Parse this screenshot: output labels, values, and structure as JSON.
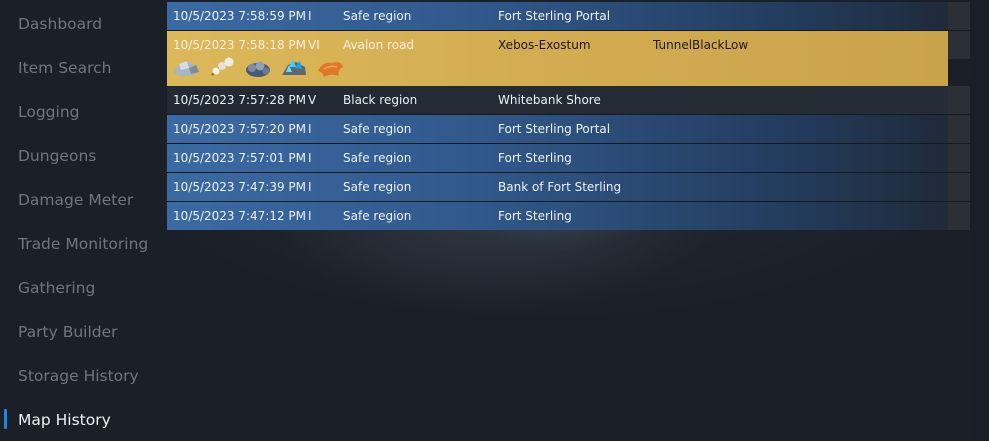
{
  "sidebar": {
    "items": [
      {
        "label": "Dashboard"
      },
      {
        "label": "Item Search"
      },
      {
        "label": "Logging"
      },
      {
        "label": "Dungeons"
      },
      {
        "label": "Damage Meter"
      },
      {
        "label": "Trade Monitoring"
      },
      {
        "label": "Gathering"
      },
      {
        "label": "Party Builder"
      },
      {
        "label": "Storage History"
      },
      {
        "label": "Map History",
        "active": true
      }
    ]
  },
  "map_history": {
    "rows": [
      {
        "time": "10/5/2023 7:58:59 PM",
        "tier": "I",
        "type": "Safe region",
        "name": "Fort Sterling Portal",
        "extra": "",
        "style": "safe"
      },
      {
        "time": "10/5/2023 7:58:18 PM",
        "tier": "VI",
        "type": "Avalon road",
        "name": "Xebos-Exostum",
        "extra": "TunnelBlackLow",
        "style": "avalon",
        "resources": [
          "stone-chunk-icon",
          "fiber-cotton-icon",
          "ore-rock-icon",
          "blue-crystal-ore-icon",
          "orange-hide-icon"
        ]
      },
      {
        "time": "10/5/2023 7:57:28 PM",
        "tier": "V",
        "type": "Black region",
        "name": "Whitebank Shore",
        "extra": "",
        "style": "black"
      },
      {
        "time": "10/5/2023 7:57:20 PM",
        "tier": "I",
        "type": "Safe region",
        "name": "Fort Sterling Portal",
        "extra": "",
        "style": "safe"
      },
      {
        "time": "10/5/2023 7:57:01 PM",
        "tier": "I",
        "type": "Safe region",
        "name": "Fort Sterling",
        "extra": "",
        "style": "safe"
      },
      {
        "time": "10/5/2023 7:47:39 PM",
        "tier": "I",
        "type": "Safe region",
        "name": "Bank of Fort Sterling",
        "extra": "",
        "style": "safe"
      },
      {
        "time": "10/5/2023 7:47:12 PM",
        "tier": "I",
        "type": "Safe region",
        "name": "Fort Sterling",
        "extra": "",
        "style": "safe"
      }
    ]
  },
  "colors": {
    "accent": "#1e88e5",
    "safe_row": "#3b6aa3",
    "avalon_row": "#dcb85a",
    "black_row": "#242a33",
    "sidebar_text": "#6f7680",
    "active_text": "#eef0f3"
  }
}
